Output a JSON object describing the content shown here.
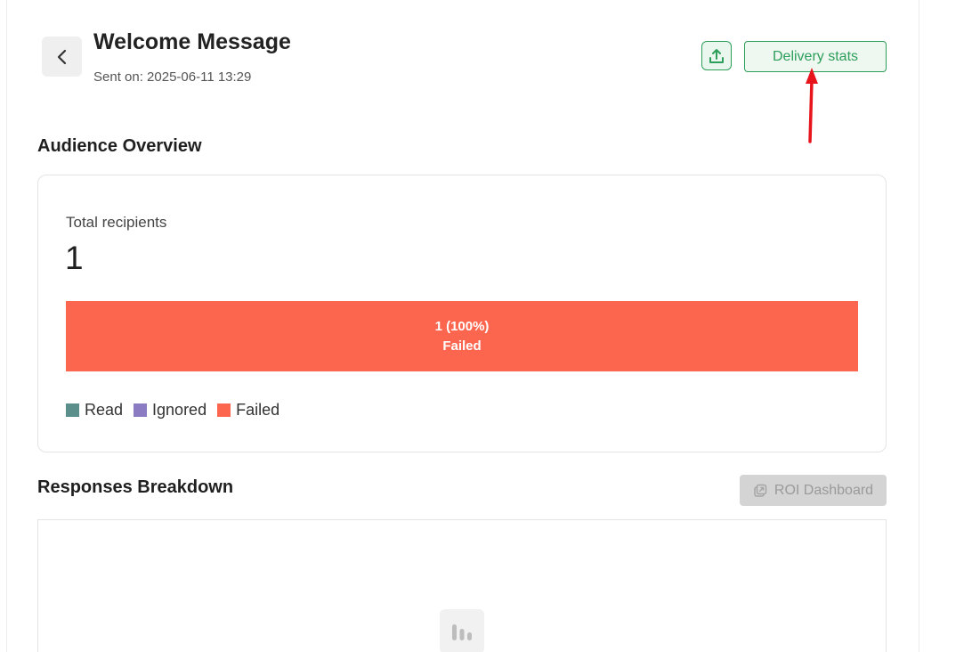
{
  "header": {
    "back_icon": "chevron-left-icon",
    "title": "Welcome Message",
    "subtitle": "Sent on: 2025-06-11 13:29",
    "export_icon": "upload-icon",
    "delivery_stats_label": "Delivery stats"
  },
  "audience": {
    "section_title": "Audience Overview",
    "recipients_label": "Total recipients",
    "recipients_count": "1",
    "bar": [
      {
        "key": "read",
        "count": 0,
        "percent": 0,
        "value_label": "",
        "status_label": "",
        "color": "#5a8f8c"
      },
      {
        "key": "ignored",
        "count": 0,
        "percent": 0,
        "value_label": "",
        "status_label": "",
        "color": "#8a7bc2"
      },
      {
        "key": "failed",
        "count": 1,
        "percent": 100,
        "value_label": "1 (100%)",
        "status_label": "Failed",
        "color": "#fc664e"
      }
    ],
    "legend": [
      {
        "label": "Read",
        "color": "#5a8f8c"
      },
      {
        "label": "Ignored",
        "color": "#8a7bc2"
      },
      {
        "label": "Failed",
        "color": "#fc664e"
      }
    ]
  },
  "responses": {
    "section_title": "Responses Breakdown",
    "roi_button_label": "ROI Dashboard",
    "roi_icon": "external-link-icon",
    "empty_state_icon": "bar-chart-icon"
  },
  "colors": {
    "brand_green": "#2e9e5b",
    "failed": "#fc664e",
    "read": "#5a8f8c",
    "ignored": "#8a7bc2",
    "annotation_red": "#e8141b"
  }
}
